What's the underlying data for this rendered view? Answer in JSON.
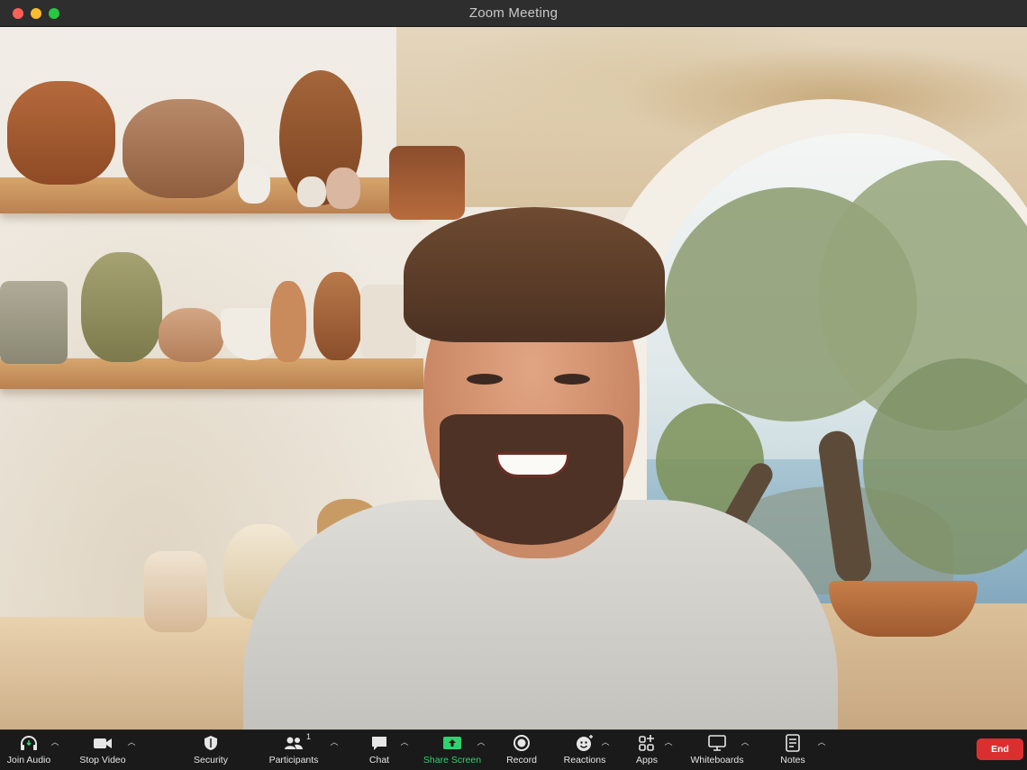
{
  "window": {
    "title": "Zoom Meeting"
  },
  "toolbar": {
    "items": [
      {
        "label": "Join Audio",
        "icon": "headphones-icon",
        "has_caret": true
      },
      {
        "label": "Stop Video",
        "icon": "video-camera-icon",
        "has_caret": true
      },
      {
        "label": "Security",
        "icon": "shield-icon",
        "has_caret": false
      },
      {
        "label": "Participants",
        "icon": "participants-icon",
        "count": "1",
        "has_caret": true
      },
      {
        "label": "Chat",
        "icon": "chat-bubble-icon",
        "has_caret": true
      },
      {
        "label": "Share Screen",
        "icon": "share-screen-icon",
        "has_caret": true,
        "accent": "#2dd36f"
      },
      {
        "label": "Record",
        "icon": "record-icon",
        "has_caret": false
      },
      {
        "label": "Reactions",
        "icon": "reactions-icon",
        "has_caret": true
      },
      {
        "label": "Apps",
        "icon": "apps-icon",
        "has_caret": true
      },
      {
        "label": "Whiteboards",
        "icon": "whiteboard-icon",
        "has_caret": true
      },
      {
        "label": "Notes",
        "icon": "notes-icon",
        "has_caret": true
      }
    ],
    "end_label": "End"
  },
  "colors": {
    "toolbar_bg": "#1a1a1a",
    "end_button": "#d9302f",
    "share_green": "#2dd36f",
    "titlebar_bg": "#2e2e2e"
  },
  "video": {
    "watermark": "backdrop"
  }
}
